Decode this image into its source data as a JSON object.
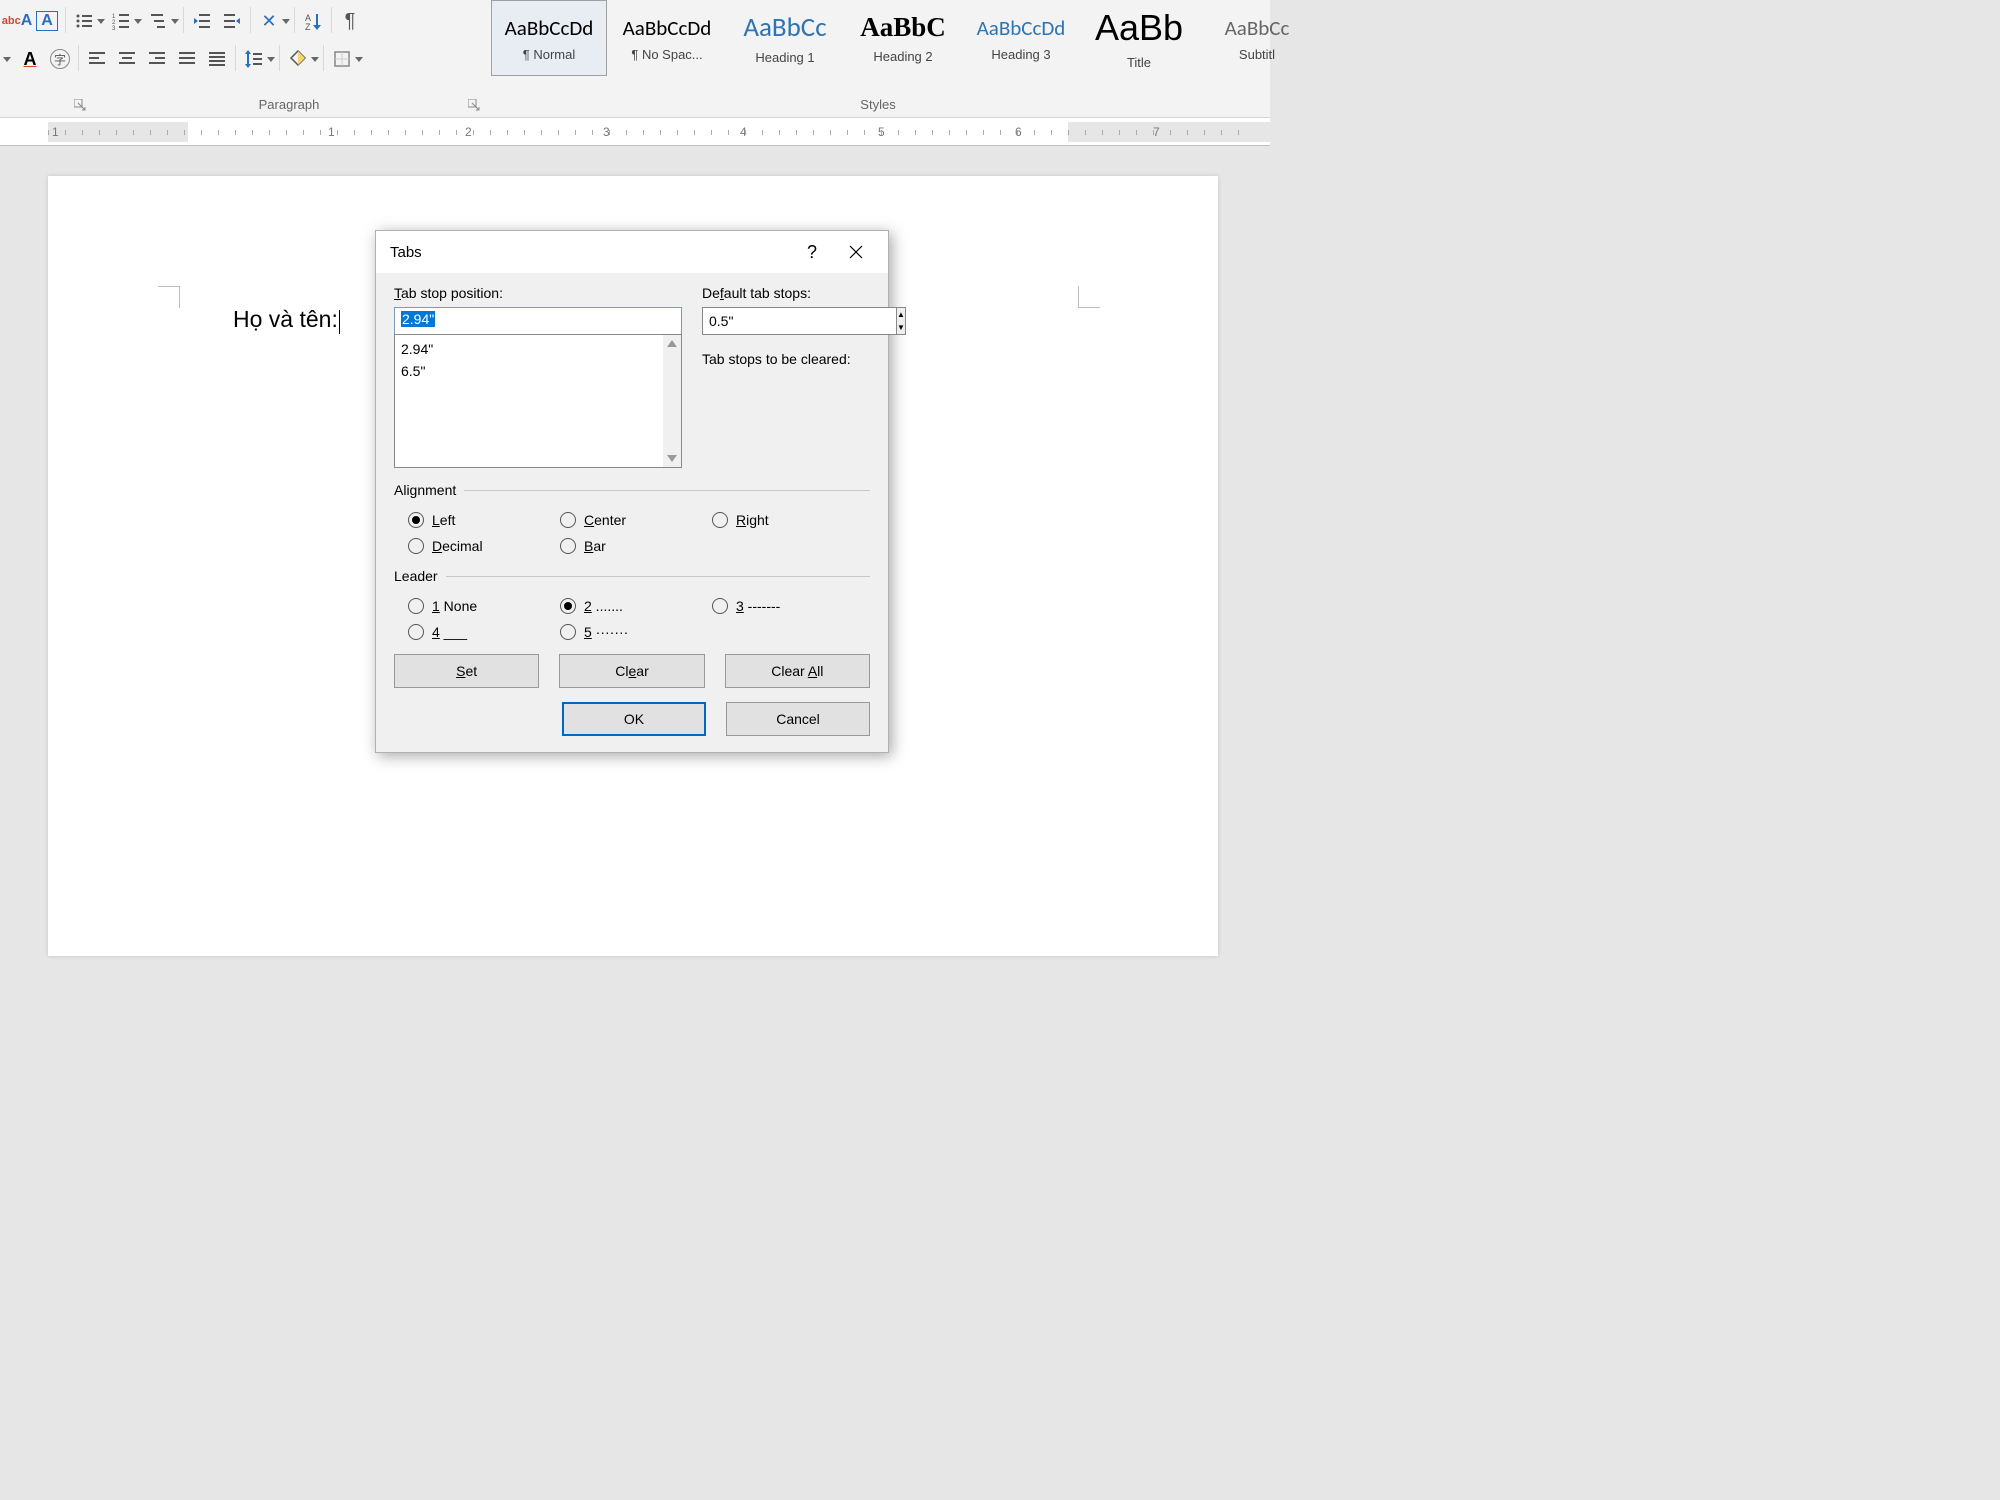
{
  "ribbon": {
    "groups": {
      "paragraph": "Paragraph",
      "styles": "Styles"
    },
    "styles": [
      {
        "preview": "AaBbCcDd",
        "label": "¶ Normal",
        "font": "normal 21px 'Calibri',sans-serif",
        "color": "#000",
        "selected": true
      },
      {
        "preview": "AaBbCcDd",
        "label": "¶ No Spac...",
        "font": "normal 21px 'Calibri',sans-serif",
        "color": "#000"
      },
      {
        "preview": "AaBbCc",
        "label": "Heading 1",
        "font": "normal 27px 'Calibri',sans-serif",
        "color": "#2e74b5"
      },
      {
        "preview": "AaBbC",
        "label": "Heading 2",
        "font": "bold 27px 'Times New Roman',serif",
        "color": "#000"
      },
      {
        "preview": "AaBbCcDd",
        "label": "Heading 3",
        "font": "normal 21px 'Calibri',sans-serif",
        "color": "#2e74b5"
      },
      {
        "preview": "AaBb",
        "label": "Title",
        "font": "normal 36px 'Calibri Light',sans-serif",
        "color": "#000"
      },
      {
        "preview": "AaBbCc",
        "label": "Subtitl",
        "font": "normal 21px 'Calibri',sans-serif",
        "color": "#666"
      }
    ]
  },
  "ruler": {
    "numbers": [
      "1",
      "1",
      "2",
      "3",
      "4",
      "5",
      "6",
      "7"
    ],
    "positions": [
      52,
      328,
      465,
      603,
      740,
      878,
      1015,
      1153
    ]
  },
  "document": {
    "text": "Họ và tên:"
  },
  "dialog": {
    "title": "Tabs",
    "tab_stop_position_label": "Tab stop position:",
    "tab_stop_position_value": "2.94\"",
    "tab_list": [
      "2.94\"",
      "6.5\""
    ],
    "default_tab_stops_label": "Default tab stops:",
    "default_tab_stops_value": "0.5\"",
    "cleared_label": "Tab stops to be cleared:",
    "alignment": {
      "legend": "Alignment",
      "options": [
        "Left",
        "Center",
        "Right",
        "Decimal",
        "Bar"
      ],
      "selected": "Left"
    },
    "leader": {
      "legend": "Leader",
      "options": [
        "1 None",
        "2 .......",
        "3 -------",
        "4 ___",
        "5 ·······"
      ],
      "selected": "2 ......."
    },
    "buttons": {
      "set": "Set",
      "clear": "Clear",
      "clear_all": "Clear All",
      "ok": "OK",
      "cancel": "Cancel"
    }
  }
}
